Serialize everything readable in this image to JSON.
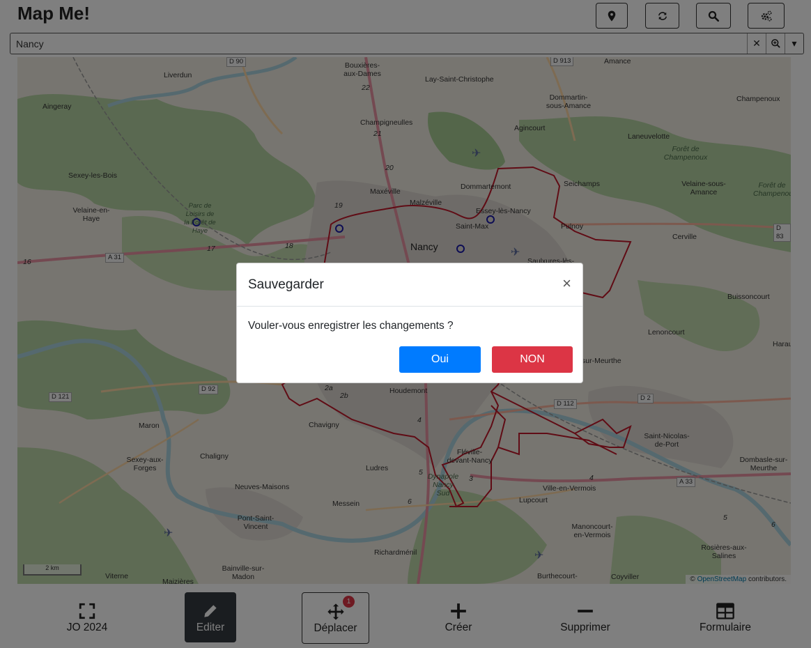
{
  "app": {
    "title": "Map Me!"
  },
  "header_buttons": [
    {
      "icon": "map-marker-icon"
    },
    {
      "icon": "refresh-icon"
    },
    {
      "icon": "search-icon"
    },
    {
      "icon": "cogs-icon"
    }
  ],
  "search": {
    "value": "Nancy",
    "clear_label": "✕",
    "dropdown_label": "▾"
  },
  "map": {
    "places": [
      {
        "name": "Liverdun"
      },
      {
        "name": "Bouxières-aux-Dames"
      },
      {
        "name": "Lay-Saint-Christophe"
      },
      {
        "name": "Amance"
      },
      {
        "name": "Aingeray"
      },
      {
        "name": "Dommartin-sous-Amance"
      },
      {
        "name": "Champenoux"
      },
      {
        "name": "Champigneulles"
      },
      {
        "name": "Agincourt"
      },
      {
        "name": "Laneuvelotte"
      },
      {
        "name": "Forêt de Champenoux"
      },
      {
        "name": "Sexey-les-Bois"
      },
      {
        "name": "Dommartemont"
      },
      {
        "name": "Seichamps"
      },
      {
        "name": "Maxéville"
      },
      {
        "name": "Velaine-sous-Amance"
      },
      {
        "name": "Forêt de Champenoux"
      },
      {
        "name": "Velaine-en-Haye"
      },
      {
        "name": "Malzéville"
      },
      {
        "name": "Essey-lès-Nancy"
      },
      {
        "name": "Parc de Loisirs de la Forêt de Haye"
      },
      {
        "name": "Saint-Max"
      },
      {
        "name": "Pulnoy"
      },
      {
        "name": "Nancy"
      },
      {
        "name": "Cerville"
      },
      {
        "name": "Saulxures-lès-"
      },
      {
        "name": "Buissoncourt"
      },
      {
        "name": "Lenoncourt"
      },
      {
        "name": "Harau"
      },
      {
        "name": "sur-Meurthe"
      },
      {
        "name": "Houdemont"
      },
      {
        "name": "Maron"
      },
      {
        "name": "Chavigny"
      },
      {
        "name": "Saint-Nicolas-de-Port"
      },
      {
        "name": "Fléville-devant-Nancy"
      },
      {
        "name": "Chaligny"
      },
      {
        "name": "Sexey-aux-Forges"
      },
      {
        "name": "Ludres"
      },
      {
        "name": "Dynapole Nancy Sud"
      },
      {
        "name": "Dombasle-sur-Meurthe"
      },
      {
        "name": "Neuves-Maisons"
      },
      {
        "name": "Ville-en-Vermois"
      },
      {
        "name": "Messein"
      },
      {
        "name": "Lupcourt"
      },
      {
        "name": "Pont-Saint-Vincent"
      },
      {
        "name": "Manoncourt-en-Vermois"
      },
      {
        "name": "Rosières-aux-Salines"
      },
      {
        "name": "Richardménil"
      },
      {
        "name": "Bainville-sur-Madon"
      },
      {
        "name": "Viterne"
      },
      {
        "name": "Maizières"
      },
      {
        "name": "Burthecourt-"
      },
      {
        "name": "Coyviller"
      }
    ],
    "roads": [
      "D 90",
      "D 913",
      "A 31",
      "D 83",
      "D 92",
      "D 121",
      "D 112",
      "D 2",
      "A 33"
    ],
    "km_markers": [
      "22",
      "21",
      "20",
      "19",
      "18",
      "17",
      "16",
      "2a",
      "2b",
      "4",
      "5",
      "3",
      "6",
      "4",
      "5",
      "6"
    ],
    "scale_label": "2 km",
    "attribution_prefix": "©",
    "attribution_link": "OpenStreetMap",
    "attribution_suffix": "contributors."
  },
  "toolbar": {
    "buttons": [
      {
        "label": "JO 2024",
        "icon": "expand-icon"
      },
      {
        "label": "Editer",
        "icon": "pencil-icon"
      },
      {
        "label": "Déplacer",
        "icon": "move-icon",
        "badge": "1"
      },
      {
        "label": "Créer",
        "icon": "plus-icon"
      },
      {
        "label": "Supprimer",
        "icon": "minus-icon"
      },
      {
        "label": "Formulaire",
        "icon": "table-icon"
      }
    ]
  },
  "modal": {
    "title": "Sauvegarder",
    "close_label": "×",
    "message": "Vouler-vous enregistrer les changements ?",
    "confirm_label": "Oui",
    "cancel_label": "NON"
  },
  "colors": {
    "primary": "#007bff",
    "danger": "#dc3545",
    "dark": "#343a40",
    "boundary": "#c0182a",
    "marker": "#1a1aa8"
  }
}
